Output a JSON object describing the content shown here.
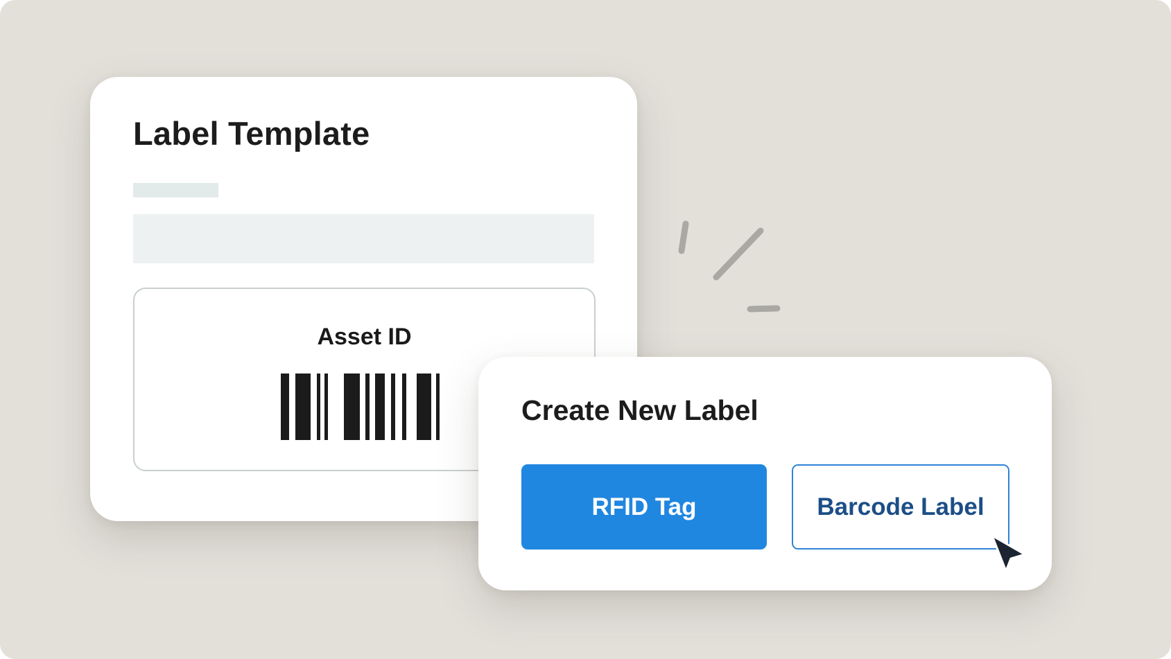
{
  "template_card": {
    "title": "Label Template",
    "preview": {
      "asset_label": "Asset ID"
    }
  },
  "create_card": {
    "title": "Create New Label",
    "rfid_button": "RFID Tag",
    "barcode_button": "Barcode Label"
  },
  "icons": {
    "cursor": "mouse-pointer-icon",
    "sparkle": "click-sparkle-icon",
    "barcode": "barcode-icon"
  },
  "colors": {
    "background": "#e3e0da",
    "card": "#ffffff",
    "primary_button": "#2087e0",
    "secondary_button_text": "#1c4e87",
    "secondary_button_border": "#2f84d6",
    "heading_text": "#1c1c1c"
  }
}
